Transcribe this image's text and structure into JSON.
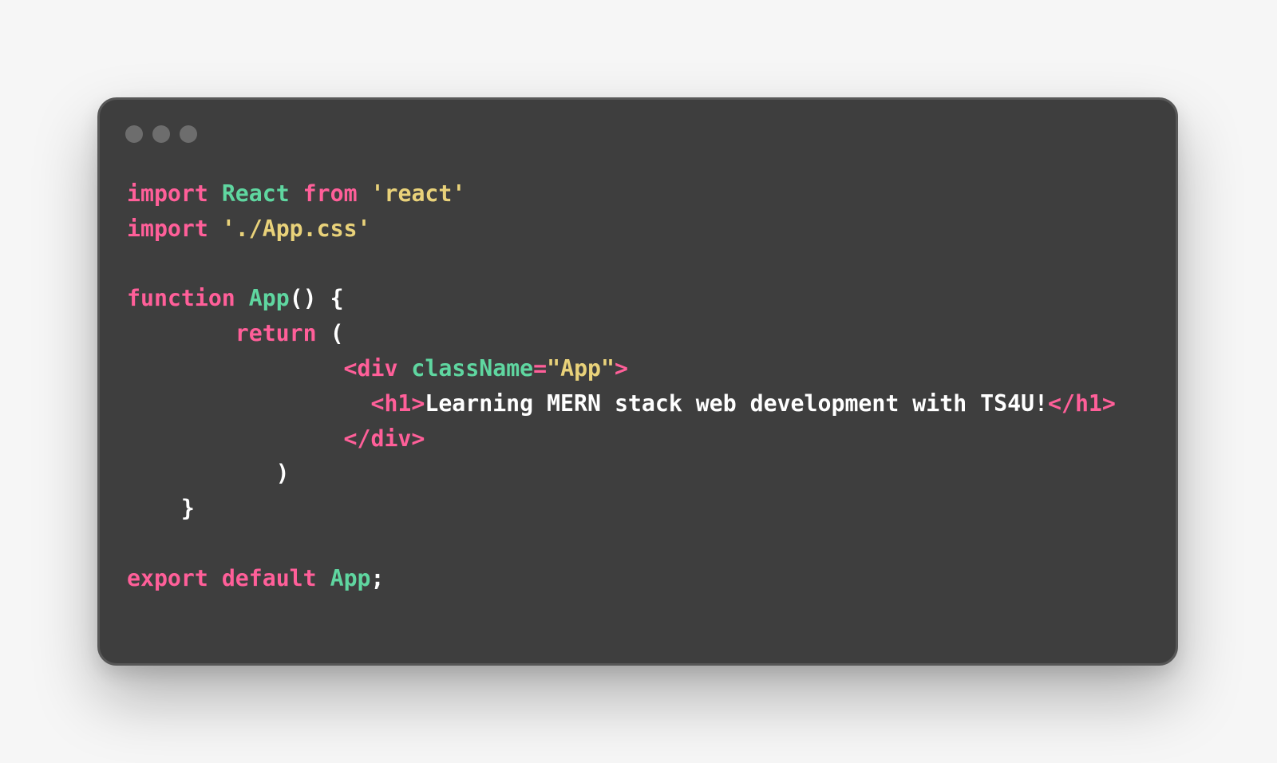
{
  "window": {
    "controls": [
      "window-dot",
      "window-dot",
      "window-dot"
    ]
  },
  "colors": {
    "background": "#f6f6f6",
    "editor_background": "#3e3e3e",
    "keyword": "#ff5f99",
    "identifier": "#5fd6a0",
    "string": "#e9d27a",
    "text": "#ffffff"
  },
  "code": {
    "lines": [
      [
        {
          "t": "import",
          "k": "keyword"
        },
        {
          "t": " ",
          "k": "text"
        },
        {
          "t": "React",
          "k": "ident"
        },
        {
          "t": " ",
          "k": "text"
        },
        {
          "t": "from",
          "k": "keyword"
        },
        {
          "t": " ",
          "k": "text"
        },
        {
          "t": "'react'",
          "k": "string"
        }
      ],
      [
        {
          "t": "import",
          "k": "keyword"
        },
        {
          "t": " ",
          "k": "text"
        },
        {
          "t": "'./App.css'",
          "k": "string"
        }
      ],
      [],
      [
        {
          "t": "function",
          "k": "keyword"
        },
        {
          "t": " ",
          "k": "text"
        },
        {
          "t": "App",
          "k": "ident"
        },
        {
          "t": "() {",
          "k": "punct"
        }
      ],
      [
        {
          "t": "        ",
          "k": "text"
        },
        {
          "t": "return",
          "k": "keyword"
        },
        {
          "t": " (",
          "k": "punct"
        }
      ],
      [
        {
          "t": "                ",
          "k": "text"
        },
        {
          "t": "<div",
          "k": "tag"
        },
        {
          "t": " ",
          "k": "text"
        },
        {
          "t": "className",
          "k": "attr"
        },
        {
          "t": "=",
          "k": "tag"
        },
        {
          "t": "\"App\"",
          "k": "string"
        },
        {
          "t": ">",
          "k": "tag"
        }
      ],
      [
        {
          "t": "                  ",
          "k": "text"
        },
        {
          "t": "<h1>",
          "k": "tag"
        },
        {
          "t": "Learning MERN stack web development with TS4U!",
          "k": "text"
        },
        {
          "t": "</h1>",
          "k": "tag"
        }
      ],
      [
        {
          "t": "                ",
          "k": "text"
        },
        {
          "t": "</div>",
          "k": "tag"
        }
      ],
      [
        {
          "t": "           )",
          "k": "punct"
        }
      ],
      [
        {
          "t": "    }",
          "k": "punct"
        }
      ],
      [],
      [
        {
          "t": "export",
          "k": "keyword"
        },
        {
          "t": " ",
          "k": "text"
        },
        {
          "t": "default",
          "k": "keyword"
        },
        {
          "t": " ",
          "k": "text"
        },
        {
          "t": "App",
          "k": "ident"
        },
        {
          "t": ";",
          "k": "punct"
        }
      ]
    ]
  }
}
